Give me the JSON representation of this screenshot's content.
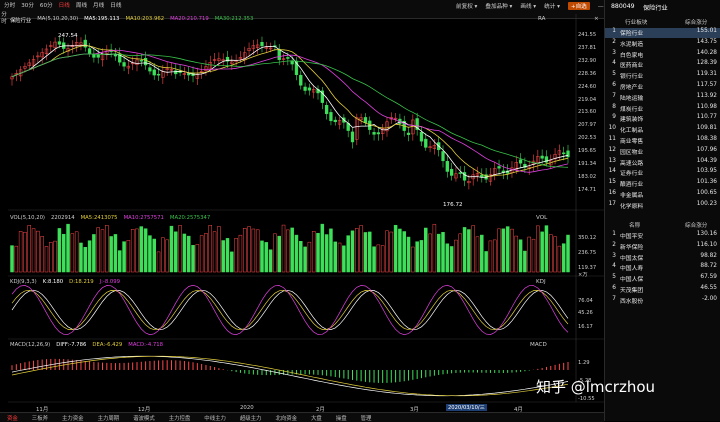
{
  "toolbar": {
    "periods": [
      "分时",
      "30分",
      "60分",
      "日线",
      "周线",
      "月线",
      "日线"
    ],
    "active_period": "日线",
    "menu": [
      "前复权",
      "叠加品种",
      "画线",
      "统计"
    ],
    "self_select": "+自选",
    "left_vertical": "分时"
  },
  "main_chart": {
    "name": "保险行业",
    "indicator": "MA(5,10,20,30)",
    "ma_values": [
      {
        "label": "MA5:195.113",
        "color": "#ffffff"
      },
      {
        "label": "MA10:203.962",
        "color": "#e3cf3a"
      },
      {
        "label": "MA20:210.719",
        "color": "#e040e0"
      },
      {
        "label": "MA30:212.353",
        "color": "#39c24a"
      }
    ],
    "y_ticks": [
      "241.55",
      "237.81",
      "232.90",
      "228.36",
      "224.60",
      "219.04",
      "213.60",
      "207.97",
      "202.53",
      "195.65",
      "191.34",
      "183.02",
      "174.71"
    ],
    "high_annotation": "247.54",
    "low_annotation": "176.72",
    "flag": "RA"
  },
  "volume_chart": {
    "indicator": "VOL(5,10,20)",
    "values": [
      {
        "label": "2202914",
        "color": "#cfcfcf"
      },
      {
        "label": "MA5:2413075",
        "color": "#e3cf3a"
      },
      {
        "label": "MA10:2757571",
        "color": "#e040e0"
      },
      {
        "label": "MA20:2575347",
        "color": "#39c24a"
      }
    ],
    "y_ticks": [
      "350.12",
      "236.75",
      "119.37",
      "×万"
    ],
    "flag": "VOL"
  },
  "kdj_chart": {
    "indicator": "KDJ(9,3,3)",
    "values": [
      {
        "label": "K:8.180",
        "color": "#ffffff"
      },
      {
        "label": "D:18.219",
        "color": "#e3cf3a"
      },
      {
        "label": "J:-8.099",
        "color": "#e040e0"
      }
    ],
    "y_ticks": [
      "76.04",
      "45.26",
      "16.17"
    ],
    "flag": "KDJ"
  },
  "macd_chart": {
    "indicator": "MACD(12,26,9)",
    "values": [
      {
        "label": "DIFF:-7.786",
        "color": "#ffffff"
      },
      {
        "label": "DEA:-6.429",
        "color": "#e3cf3a"
      },
      {
        "label": "MACD:-4.718",
        "color": "#e040e0"
      }
    ],
    "y_ticks": [
      "1.29",
      "-5.28",
      "-10.55"
    ],
    "flag": "MACD"
  },
  "x_axis": [
    "11月",
    "12月",
    "2020",
    "2月",
    "3月",
    "4月"
  ],
  "date_box": "2020/03/10/三",
  "bottom_tabs": [
    "资金",
    "三板斧",
    "主力资金",
    "主力周期",
    "谐波模式",
    "主力控盘",
    "中线主力",
    "超级主力",
    "北向资金",
    "大盘",
    "操盘",
    "管理"
  ],
  "active_tab": "资金",
  "right_panel": {
    "code": "880049",
    "title": "保险行业",
    "header_rank": "行业板块",
    "header_score": "综合涨分",
    "sectors": [
      {
        "rank": "1",
        "name": "保险行业",
        "score": "155.01"
      },
      {
        "rank": "2",
        "name": "水泥制造",
        "score": "143.75"
      },
      {
        "rank": "3",
        "name": "白色家电",
        "score": "140.28"
      },
      {
        "rank": "4",
        "name": "医药商业",
        "score": "128.39"
      },
      {
        "rank": "5",
        "name": "银行行业",
        "score": "119.31"
      },
      {
        "rank": "6",
        "name": "房地产业",
        "score": "117.57"
      },
      {
        "rank": "7",
        "name": "陆地运输",
        "score": "113.92"
      },
      {
        "rank": "8",
        "name": "煤炭行业",
        "score": "110.98"
      },
      {
        "rank": "9",
        "name": "建筑装饰",
        "score": "110.77"
      },
      {
        "rank": "10",
        "name": "化工制品",
        "score": "109.81"
      },
      {
        "rank": "11",
        "name": "商业零售",
        "score": "108.38"
      },
      {
        "rank": "12",
        "name": "园区物业",
        "score": "107.96"
      },
      {
        "rank": "13",
        "name": "高速公路",
        "score": "104.39"
      },
      {
        "rank": "14",
        "name": "证券行业",
        "score": "103.95"
      },
      {
        "rank": "15",
        "name": "酿酒行业",
        "score": "101.36"
      },
      {
        "rank": "16",
        "name": "非金属品",
        "score": "100.65"
      },
      {
        "rank": "17",
        "name": "化学原料",
        "score": "100.23"
      }
    ],
    "header2_name": "名称",
    "header2_score": "综合涨分",
    "stocks": [
      {
        "rank": "1",
        "name": "中国平安",
        "score": "130.16"
      },
      {
        "rank": "2",
        "name": "新华保险",
        "score": "116.10"
      },
      {
        "rank": "3",
        "name": "中国太保",
        "score": "98.82"
      },
      {
        "rank": "4",
        "name": "中国人寿",
        "score": "88.72"
      },
      {
        "rank": "5",
        "name": "中国人保",
        "score": "67.59"
      },
      {
        "rank": "6",
        "name": "天茂集团",
        "score": "46.55"
      },
      {
        "rank": "7",
        "name": "西水股份",
        "score": "-2.00"
      }
    ]
  },
  "watermark": "知乎 @lmcrzhou"
}
